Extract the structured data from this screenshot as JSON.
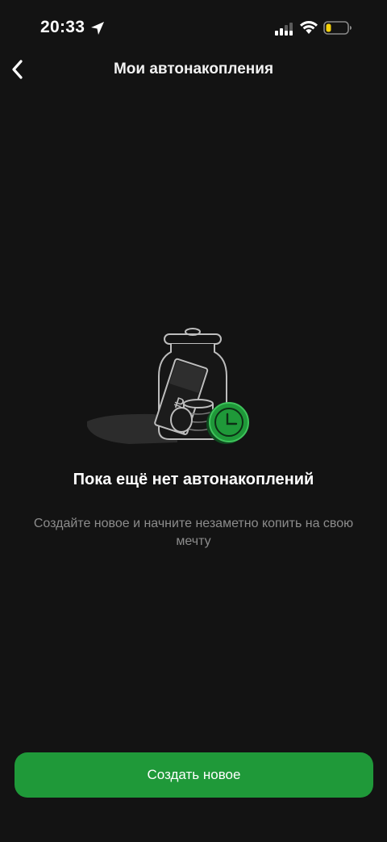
{
  "status_bar": {
    "time": "20:33",
    "icons": [
      "location-arrow-icon",
      "cellular-signal-icon",
      "wifi-icon",
      "battery-low-icon"
    ],
    "battery_color": "#f5d20a"
  },
  "nav": {
    "title": "Мои автонакопления",
    "back_icon": "chevron-left-icon"
  },
  "empty_state": {
    "illustration": "savings-jar-with-banknote-coins-and-clock",
    "title": "Пока ещё нет автонакоплений",
    "subtitle": "Создайте новое и начните незаметно копить на свою мечту"
  },
  "actions": {
    "create_label": "Создать новое"
  },
  "colors": {
    "background": "#131313",
    "accent": "#1f9939",
    "text_primary": "#ffffff",
    "text_secondary": "#8c8c8c"
  }
}
